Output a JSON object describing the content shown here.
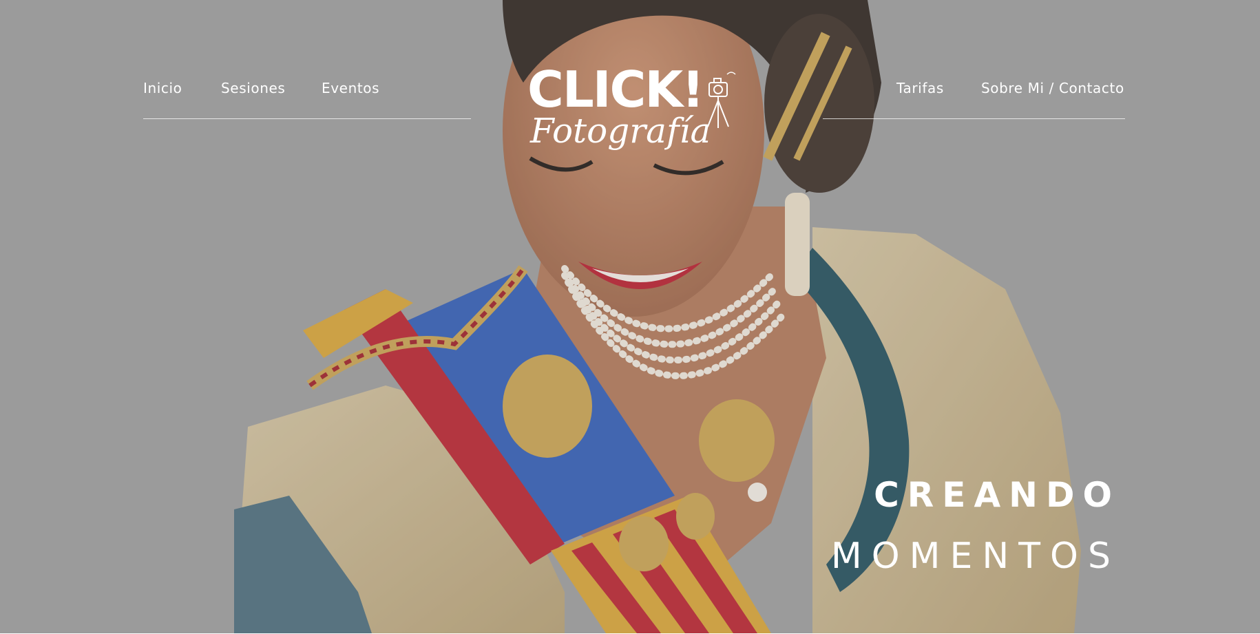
{
  "nav": {
    "left": [
      "Inicio",
      "Sesiones",
      "Eventos"
    ],
    "right": [
      "Tarifas",
      "Sobre Mi / Contacto"
    ]
  },
  "logo": {
    "title": "CLICK!",
    "subtitle": "Fotografía",
    "icon": "camera-on-tripod-icon"
  },
  "hero": {
    "headline_line1": "CREANDO",
    "headline_line2": "MOMENTOS",
    "image": "portrait-photo"
  },
  "colors": {
    "background": "#9b9b9b",
    "text": "#ffffff"
  }
}
